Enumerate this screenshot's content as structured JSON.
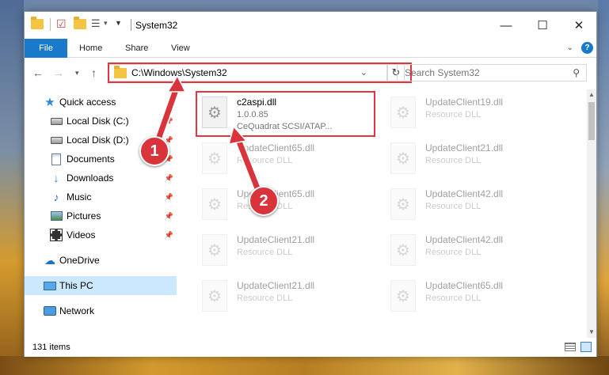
{
  "window": {
    "title": "System32"
  },
  "title_controls": {
    "minimize": "—",
    "maximize": "☐",
    "close": "✕"
  },
  "ribbon": {
    "tabs": [
      {
        "label": "File"
      },
      {
        "label": "Home"
      },
      {
        "label": "Share"
      },
      {
        "label": "View"
      }
    ],
    "accent": "#1979ca"
  },
  "navigation": {
    "address": "C:\\Windows\\System32",
    "search_placeholder": "Search System32"
  },
  "sidebar": {
    "items": [
      {
        "label": "Quick access",
        "icon": "star-icon"
      },
      {
        "label": "Local Disk (C:)",
        "icon": "drive-icon",
        "pinned": true
      },
      {
        "label": "Local Disk (D:)",
        "icon": "drive-icon",
        "pinned": true
      },
      {
        "label": "Documents",
        "icon": "document-icon",
        "pinned": true
      },
      {
        "label": "Downloads",
        "icon": "download-icon",
        "pinned": true
      },
      {
        "label": "Music",
        "icon": "music-icon",
        "pinned": true
      },
      {
        "label": "Pictures",
        "icon": "picture-icon",
        "pinned": true
      },
      {
        "label": "Videos",
        "icon": "video-icon",
        "pinned": true
      },
      {
        "label": "OneDrive",
        "icon": "cloud-icon"
      },
      {
        "label": "This PC",
        "icon": "computer-icon",
        "selected": true
      },
      {
        "label": "Network",
        "icon": "network-icon"
      }
    ]
  },
  "files": [
    {
      "name": "c2aspi.dll",
      "line2": "1.0.0.85",
      "line3": "CeQuadrat SCSI/ATAP...",
      "highlighted": true
    },
    {
      "name": "UpdateClient19.dll",
      "line2": "Resource DLL"
    },
    {
      "name": "UpdateClient65.dll",
      "line2": "Resource DLL"
    },
    {
      "name": "UpdateClient21.dll",
      "line2": "Resource DLL"
    },
    {
      "name": "UpdateClient65.dll",
      "line2": "Resource DLL"
    },
    {
      "name": "UpdateClient42.dll",
      "line2": "Resource DLL"
    },
    {
      "name": "UpdateClient21.dll",
      "line2": "Resource DLL"
    },
    {
      "name": "UpdateClient42.dll",
      "line2": "Resource DLL"
    },
    {
      "name": "UpdateClient21.dll",
      "line2": "Resource DLL"
    },
    {
      "name": "UpdateClient65.dll",
      "line2": "Resource DLL"
    }
  ],
  "status": {
    "item_count": "131 items"
  },
  "annotations": {
    "marker1": "1",
    "marker2": "2",
    "color": "#d9333b"
  }
}
